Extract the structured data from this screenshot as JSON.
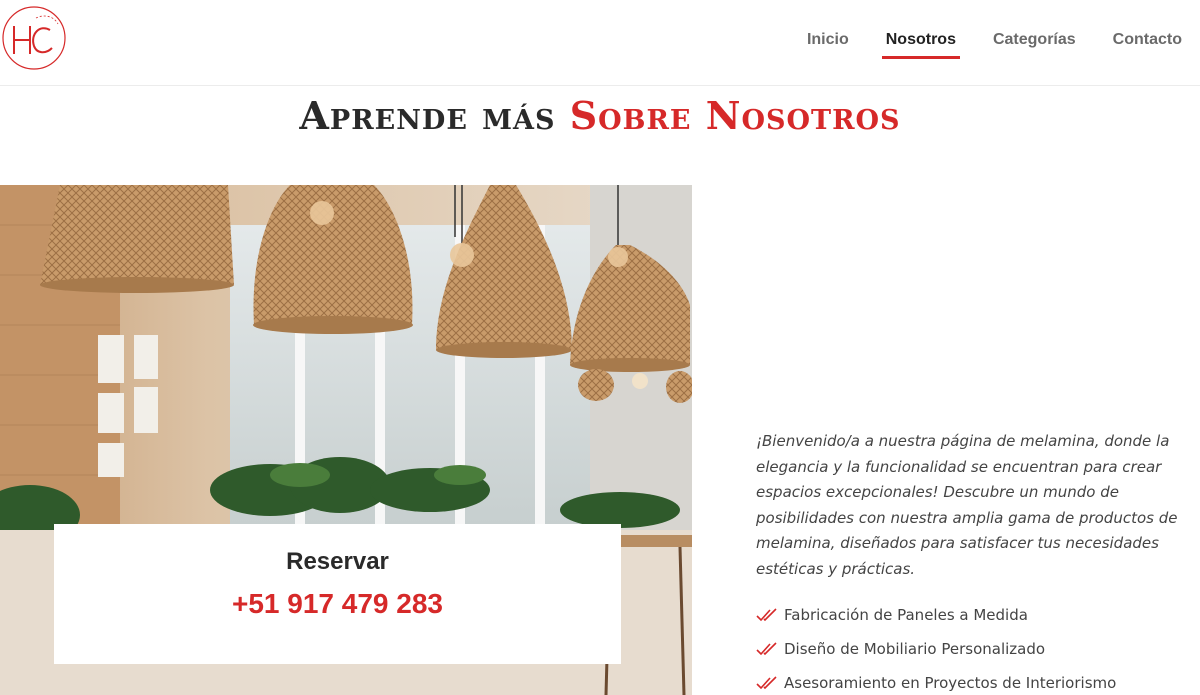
{
  "header": {
    "logo_text": "HC",
    "nav": [
      {
        "label": "Inicio"
      },
      {
        "label": "Nosotros"
      },
      {
        "label": "Categorías"
      },
      {
        "label": "Contacto"
      }
    ]
  },
  "section": {
    "title_dark": "Aprende más",
    "title_red": "Sobre Nosotros"
  },
  "booking": {
    "title": "Reservar",
    "phone": "+51 917 479 283"
  },
  "about": {
    "intro": "¡Bienvenido/a a nuestra página de melamina, donde la elegancia y la funcionalidad se encuentran para crear espacios excepcionales! Descubre un mundo de posibilidades con nuestra amplia gama de productos de melamina, diseñados para satisfacer tus necesidades estéticas y prácticas.",
    "features": [
      "Fabricación de Paneles a Medida",
      "Diseño de Mobiliario Personalizado",
      "Asesoramiento en Proyectos de Interiorismo"
    ]
  },
  "colors": {
    "accent": "#d62929",
    "text_dark": "#2a2a2a",
    "nav_text": "#6a6a6a"
  },
  "icons": {
    "feature_bullet": "double-check-icon"
  }
}
